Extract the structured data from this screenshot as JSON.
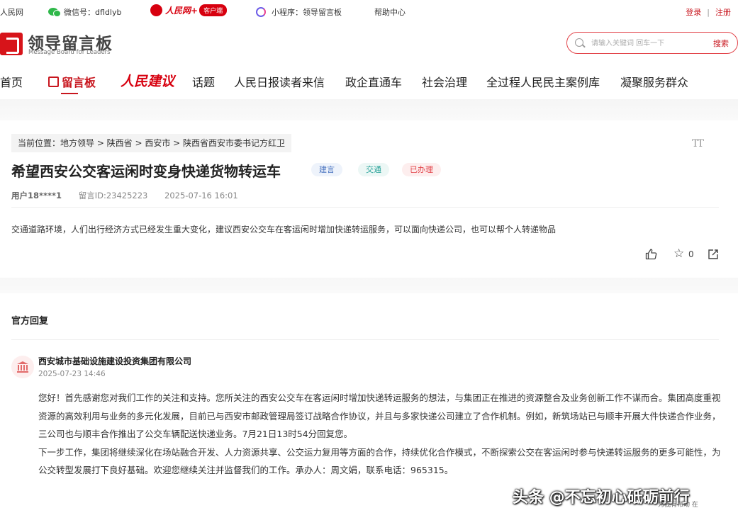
{
  "topbar": {
    "site_link": "人民网",
    "wechat": "微信号：dfldlyb",
    "rmw_text": "人民网+",
    "rmw_badge": "客户端",
    "miniprogram": "小程序：领导留言板",
    "help": "帮助中心",
    "login": "登录",
    "separator": "|",
    "register": "注册"
  },
  "logo": {
    "cn": "领导留言板",
    "en": "Message Board for Leaders"
  },
  "search": {
    "placeholder": "请输入关键词 回车一下",
    "button": "搜索"
  },
  "nav": {
    "items": [
      "首页",
      "留言板",
      "人民建议",
      "话题",
      "人民日报读者来信",
      "政企直通车",
      "社会治理",
      "全过程人民民主案例库",
      "凝聚服务群众"
    ]
  },
  "article": {
    "breadcrumb": "当前位置：地方领导 > 陕西省 > 西安市 > 陕西省西安市委书记方红卫",
    "font_toggle": "TT",
    "title": "希望西安公交客运闲时变身快递货物转运车",
    "tags": [
      "建言",
      "交通",
      "已办理"
    ],
    "user": "用户18****1",
    "message_id": "留言ID:23425223",
    "datetime": "2025-07-16 16:01",
    "content": "交通道路环境，人们出行经济方式已经发生重大变化，建议西安公交车在客运闲时增加快递转运服务，可以面向快递公司，也可以帮个人转递物品",
    "star_count": "0"
  },
  "reply": {
    "heading": "官方回复",
    "org": "西安城市基础设施建设投资集团有限公司",
    "date": "2025-07-23 14:46",
    "para1": "您好！首先感谢您对我们工作的关注和支持。您所关注的西安公交车在客运闲时增加快递转运服务的想法，与集团正在推进的资源整合及业务创新工作不谋而合。集团高度重视资源的高效利用与业务的多元化发展，目前已与西安市邮政管理局签订战略合作协议，并且与多家快递公司建立了合作机制。例如，新筑场站已与顺丰开展大件快递合作业务，三公司也与顺丰合作推出了公交车辆配送快递业务。7月21日13时54分回复您。",
    "para2": "下一步工作，集团将继续深化在场站融合开发、人力资源共享、公交运力复用等方面的合作，持续优化合作模式，不断探索公交在客运闲时参与快递转运服务的更多可能性，为公交转型发展打下良好基础。欢迎您继续关注并监督我们的工作。承办人：周文娟，联系电话：965315。"
  },
  "watermark": {
    "text": "头条 @不忘初心砥砺前行",
    "sub": "为我有布动 在"
  }
}
